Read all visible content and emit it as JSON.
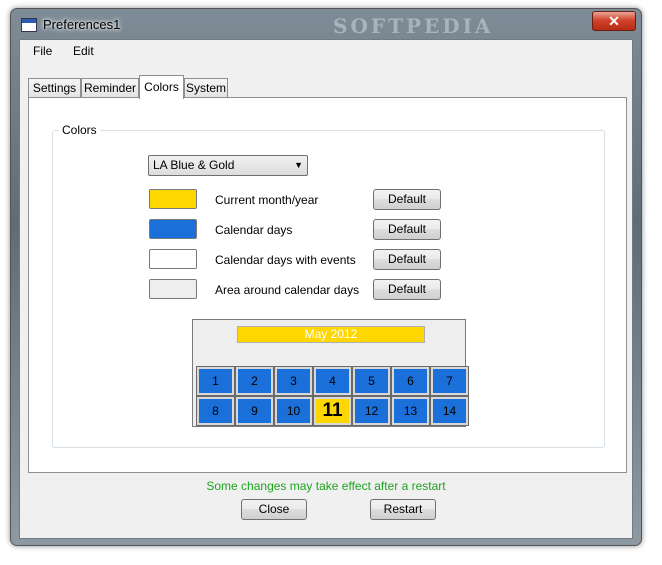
{
  "window": {
    "title": "Preferences1",
    "watermark": "SOFTPEDIA",
    "close_glyph": "✕"
  },
  "menu": {
    "items": [
      {
        "label": "File"
      },
      {
        "label": "Edit"
      }
    ]
  },
  "tabs": [
    {
      "label": "Settings",
      "active": false
    },
    {
      "label": "Reminder",
      "active": false
    },
    {
      "label": "Colors",
      "active": true
    },
    {
      "label": "System",
      "active": false
    }
  ],
  "colors_group": {
    "legend": "Colors",
    "scheme_select": {
      "value": "LA Blue & Gold"
    },
    "rows": [
      {
        "label": "Current month/year",
        "swatch": "#ffd700",
        "button": "Default"
      },
      {
        "label": "Calendar days",
        "swatch": "#1a6fd8",
        "button": "Default"
      },
      {
        "label": "Calendar days with events",
        "swatch": "#ffffff",
        "button": "Default"
      },
      {
        "label": "Area around calendar days",
        "swatch": "#eeeeee",
        "button": "Default"
      }
    ]
  },
  "preview": {
    "header": "May 2012",
    "week1": [
      "1",
      "2",
      "3",
      "4",
      "5",
      "6",
      "7"
    ],
    "week2": [
      "8",
      "9",
      "10",
      "11",
      "12",
      "13",
      "14"
    ],
    "today": "11"
  },
  "footer": {
    "message": "Some changes may take effect after a restart",
    "close_label": "Close",
    "restart_label": "Restart"
  },
  "colors": {
    "gold": "#ffd700",
    "blue": "#1a6fd8",
    "status_green": "#1fa41f"
  }
}
